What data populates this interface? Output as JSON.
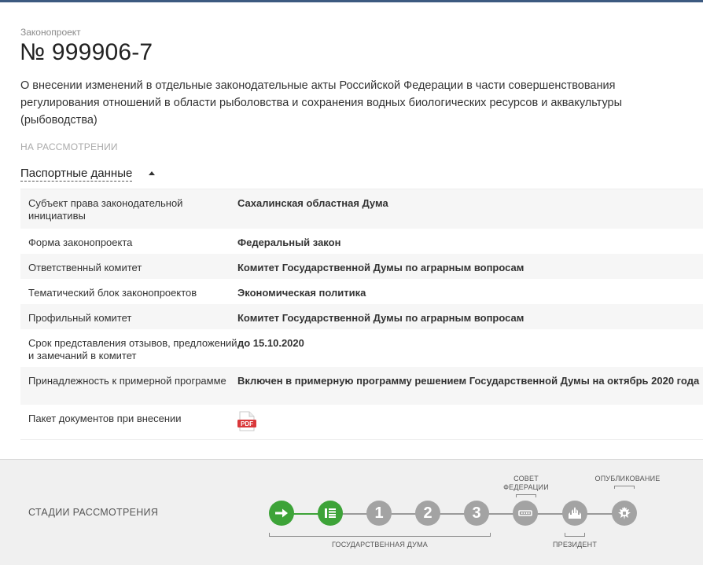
{
  "bill": {
    "kicker": "Законопроект",
    "number": "№ 999906-7",
    "description": "О внесении изменений в отдельные законодательные акты Российской Федерации в части совершенствования регулирования отношений в области рыболовства и сохранения водных биологических ресурсов и аквакультуры (рыбоводства)",
    "status": "НА РАССМОТРЕНИИ"
  },
  "passport": {
    "toggle_label": "Паспортные данные",
    "rows": [
      {
        "label": "Субъект права законодательной инициативы",
        "value": "Сахалинская областная Дума"
      },
      {
        "label": "Форма законопроекта",
        "value": "Федеральный закон"
      },
      {
        "label": "Ответственный комитет",
        "value": "Комитет Государственной Думы по аграрным вопросам"
      },
      {
        "label": "Тематический блок законопроектов",
        "value": "Экономическая политика"
      },
      {
        "label": "Профильный комитет",
        "value": "Комитет Государственной Думы по аграрным вопросам"
      },
      {
        "label": "Срок представления отзывов, предложений и замечаний в комитет",
        "value": "до 15.10.2020"
      },
      {
        "label": "Принадлежность к примерной программе",
        "value": "Включен в примерную программу решением Государственной Думы на октябрь 2020 года"
      },
      {
        "label": "Пакет документов при внесении",
        "value": "",
        "icon": "pdf-icon",
        "icon_text": "PDF"
      }
    ]
  },
  "stages": {
    "title": "СТАДИИ РАССМОТРЕНИЯ",
    "steps": [
      {
        "icon": "arrow-right-icon",
        "state": "done",
        "text": ""
      },
      {
        "icon": "document-list-icon",
        "state": "done",
        "text": ""
      },
      {
        "icon": "reading-1-icon",
        "state": "todo",
        "text": "1"
      },
      {
        "icon": "reading-2-icon",
        "state": "todo",
        "text": "2"
      },
      {
        "icon": "reading-3-icon",
        "state": "todo",
        "text": "3"
      },
      {
        "icon": "federation-council-icon",
        "state": "todo",
        "text": ""
      },
      {
        "icon": "kremlin-icon",
        "state": "todo",
        "text": ""
      },
      {
        "icon": "eagle-emblem-icon",
        "state": "todo",
        "text": ""
      }
    ],
    "labels": {
      "duma": "ГОСУДАРСТВЕННАЯ ДУМА",
      "council_line1": "СОВЕТ",
      "council_line2": "ФЕДЕРАЦИИ",
      "published": "ОПУБЛИКОВАНИЕ",
      "president": "ПРЕЗИДЕНТ"
    },
    "colors": {
      "done": "#3da338",
      "todo": "#a3a3a3"
    }
  }
}
